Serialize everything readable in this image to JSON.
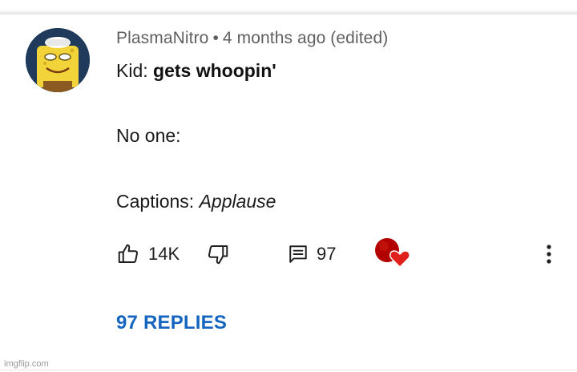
{
  "comment": {
    "author": "PlasmaNitro",
    "separator": "•",
    "timestamp": "4 months ago (edited)",
    "text": {
      "line1_prefix": "Kid: ",
      "line1_bold": "gets whoopin'",
      "line2": "No one:",
      "line3_prefix": "Captions: ",
      "line3_italic": "Applause"
    },
    "actions": {
      "like_count": "14K",
      "reply_count": "97",
      "like_icon": "thumbs-up-icon",
      "dislike_icon": "thumbs-down-icon",
      "reply_icon": "comment-icon",
      "heart_icon": "creator-heart-icon",
      "more_icon": "more-vertical-icon"
    },
    "replies_label": "97 REPLIES"
  },
  "watermark": "imgflip.com",
  "colors": {
    "link_blue": "#1565c0",
    "meta_gray": "#606060",
    "heart_red": "#e0201a",
    "creator_avatar_red": "#b30000"
  }
}
